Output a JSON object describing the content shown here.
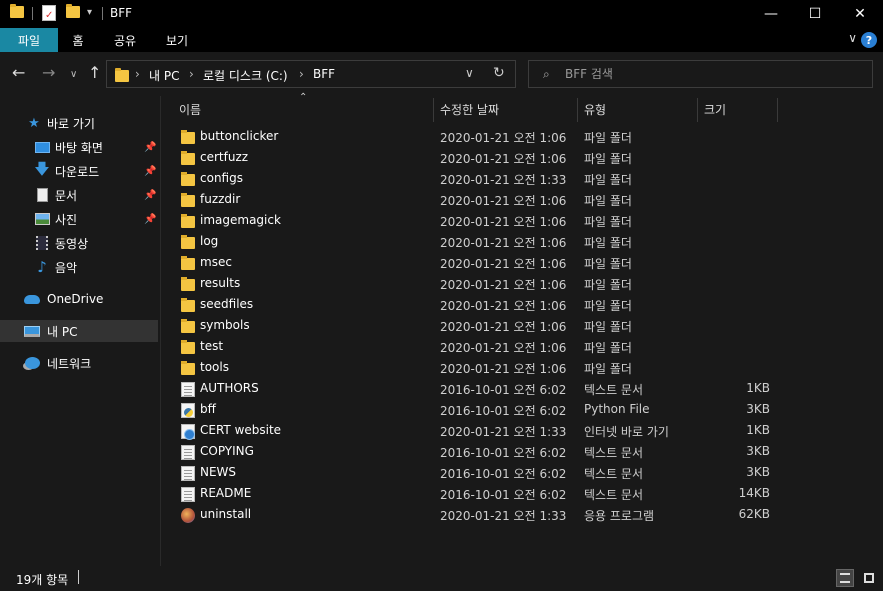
{
  "window": {
    "title": "BFF",
    "minimize_glyph": "—",
    "maximize_glyph": "☐",
    "close_glyph": "✕"
  },
  "ribbon": {
    "tabs": [
      {
        "label": "파일",
        "active": true
      },
      {
        "label": "홈"
      },
      {
        "label": "공유"
      },
      {
        "label": "보기"
      }
    ],
    "help_label": "?"
  },
  "address_bar": {
    "crumbs": [
      "내 PC",
      "로컬 디스크 (C:)",
      "BFF"
    ]
  },
  "search": {
    "placeholder": "BFF 검색"
  },
  "sidebar": {
    "quick_access": {
      "label": "바로 가기",
      "icon": "star-icon"
    },
    "pinned": [
      {
        "label": "바탕 화면",
        "icon": "desktop-icon"
      },
      {
        "label": "다운로드",
        "icon": "download-icon"
      },
      {
        "label": "문서",
        "icon": "documents-icon"
      },
      {
        "label": "사진",
        "icon": "pictures-icon"
      }
    ],
    "unpinned": [
      {
        "label": "동영상",
        "icon": "videos-icon"
      },
      {
        "label": "음악",
        "icon": "music-icon"
      }
    ],
    "onedrive": {
      "label": "OneDrive",
      "icon": "cloud-icon"
    },
    "this_pc": {
      "label": "내 PC",
      "icon": "computer-icon"
    },
    "network": {
      "label": "네트워크",
      "icon": "network-icon"
    }
  },
  "columns": {
    "name": "이름",
    "modified": "수정한 날짜",
    "type": "유형",
    "size": "크기"
  },
  "files": [
    {
      "name": "buttonclicker",
      "modified": "2020-01-21 오전 1:06",
      "type": "파일 폴더",
      "size": "",
      "icon": "folder"
    },
    {
      "name": "certfuzz",
      "modified": "2020-01-21 오전 1:06",
      "type": "파일 폴더",
      "size": "",
      "icon": "folder"
    },
    {
      "name": "configs",
      "modified": "2020-01-21 오전 1:33",
      "type": "파일 폴더",
      "size": "",
      "icon": "folder"
    },
    {
      "name": "fuzzdir",
      "modified": "2020-01-21 오전 1:06",
      "type": "파일 폴더",
      "size": "",
      "icon": "folder"
    },
    {
      "name": "imagemagick",
      "modified": "2020-01-21 오전 1:06",
      "type": "파일 폴더",
      "size": "",
      "icon": "folder"
    },
    {
      "name": "log",
      "modified": "2020-01-21 오전 1:06",
      "type": "파일 폴더",
      "size": "",
      "icon": "folder"
    },
    {
      "name": "msec",
      "modified": "2020-01-21 오전 1:06",
      "type": "파일 폴더",
      "size": "",
      "icon": "folder"
    },
    {
      "name": "results",
      "modified": "2020-01-21 오전 1:06",
      "type": "파일 폴더",
      "size": "",
      "icon": "folder"
    },
    {
      "name": "seedfiles",
      "modified": "2020-01-21 오전 1:06",
      "type": "파일 폴더",
      "size": "",
      "icon": "folder"
    },
    {
      "name": "symbols",
      "modified": "2020-01-21 오전 1:06",
      "type": "파일 폴더",
      "size": "",
      "icon": "folder"
    },
    {
      "name": "test",
      "modified": "2020-01-21 오전 1:06",
      "type": "파일 폴더",
      "size": "",
      "icon": "folder"
    },
    {
      "name": "tools",
      "modified": "2020-01-21 오전 1:06",
      "type": "파일 폴더",
      "size": "",
      "icon": "folder"
    },
    {
      "name": "AUTHORS",
      "modified": "2016-10-01 오전 6:02",
      "type": "텍스트 문서",
      "size": "1KB",
      "icon": "doc"
    },
    {
      "name": "bff",
      "modified": "2016-10-01 오전 6:02",
      "type": "Python File",
      "size": "3KB",
      "icon": "python"
    },
    {
      "name": "CERT website",
      "modified": "2020-01-21 오전 1:33",
      "type": "인터넷 바로 가기",
      "size": "1KB",
      "icon": "url"
    },
    {
      "name": "COPYING",
      "modified": "2016-10-01 오전 6:02",
      "type": "텍스트 문서",
      "size": "3KB",
      "icon": "doc"
    },
    {
      "name": "NEWS",
      "modified": "2016-10-01 오전 6:02",
      "type": "텍스트 문서",
      "size": "3KB",
      "icon": "doc"
    },
    {
      "name": "README",
      "modified": "2016-10-01 오전 6:02",
      "type": "텍스트 문서",
      "size": "14KB",
      "icon": "doc"
    },
    {
      "name": "uninstall",
      "modified": "2020-01-21 오전 1:33",
      "type": "응용 프로그램",
      "size": "62KB",
      "icon": "app"
    }
  ],
  "status": {
    "item_count": "19개 항목"
  },
  "colors": {
    "accent_tab": "#1a88a3",
    "background": "#191919",
    "folder": "#f4c542"
  }
}
